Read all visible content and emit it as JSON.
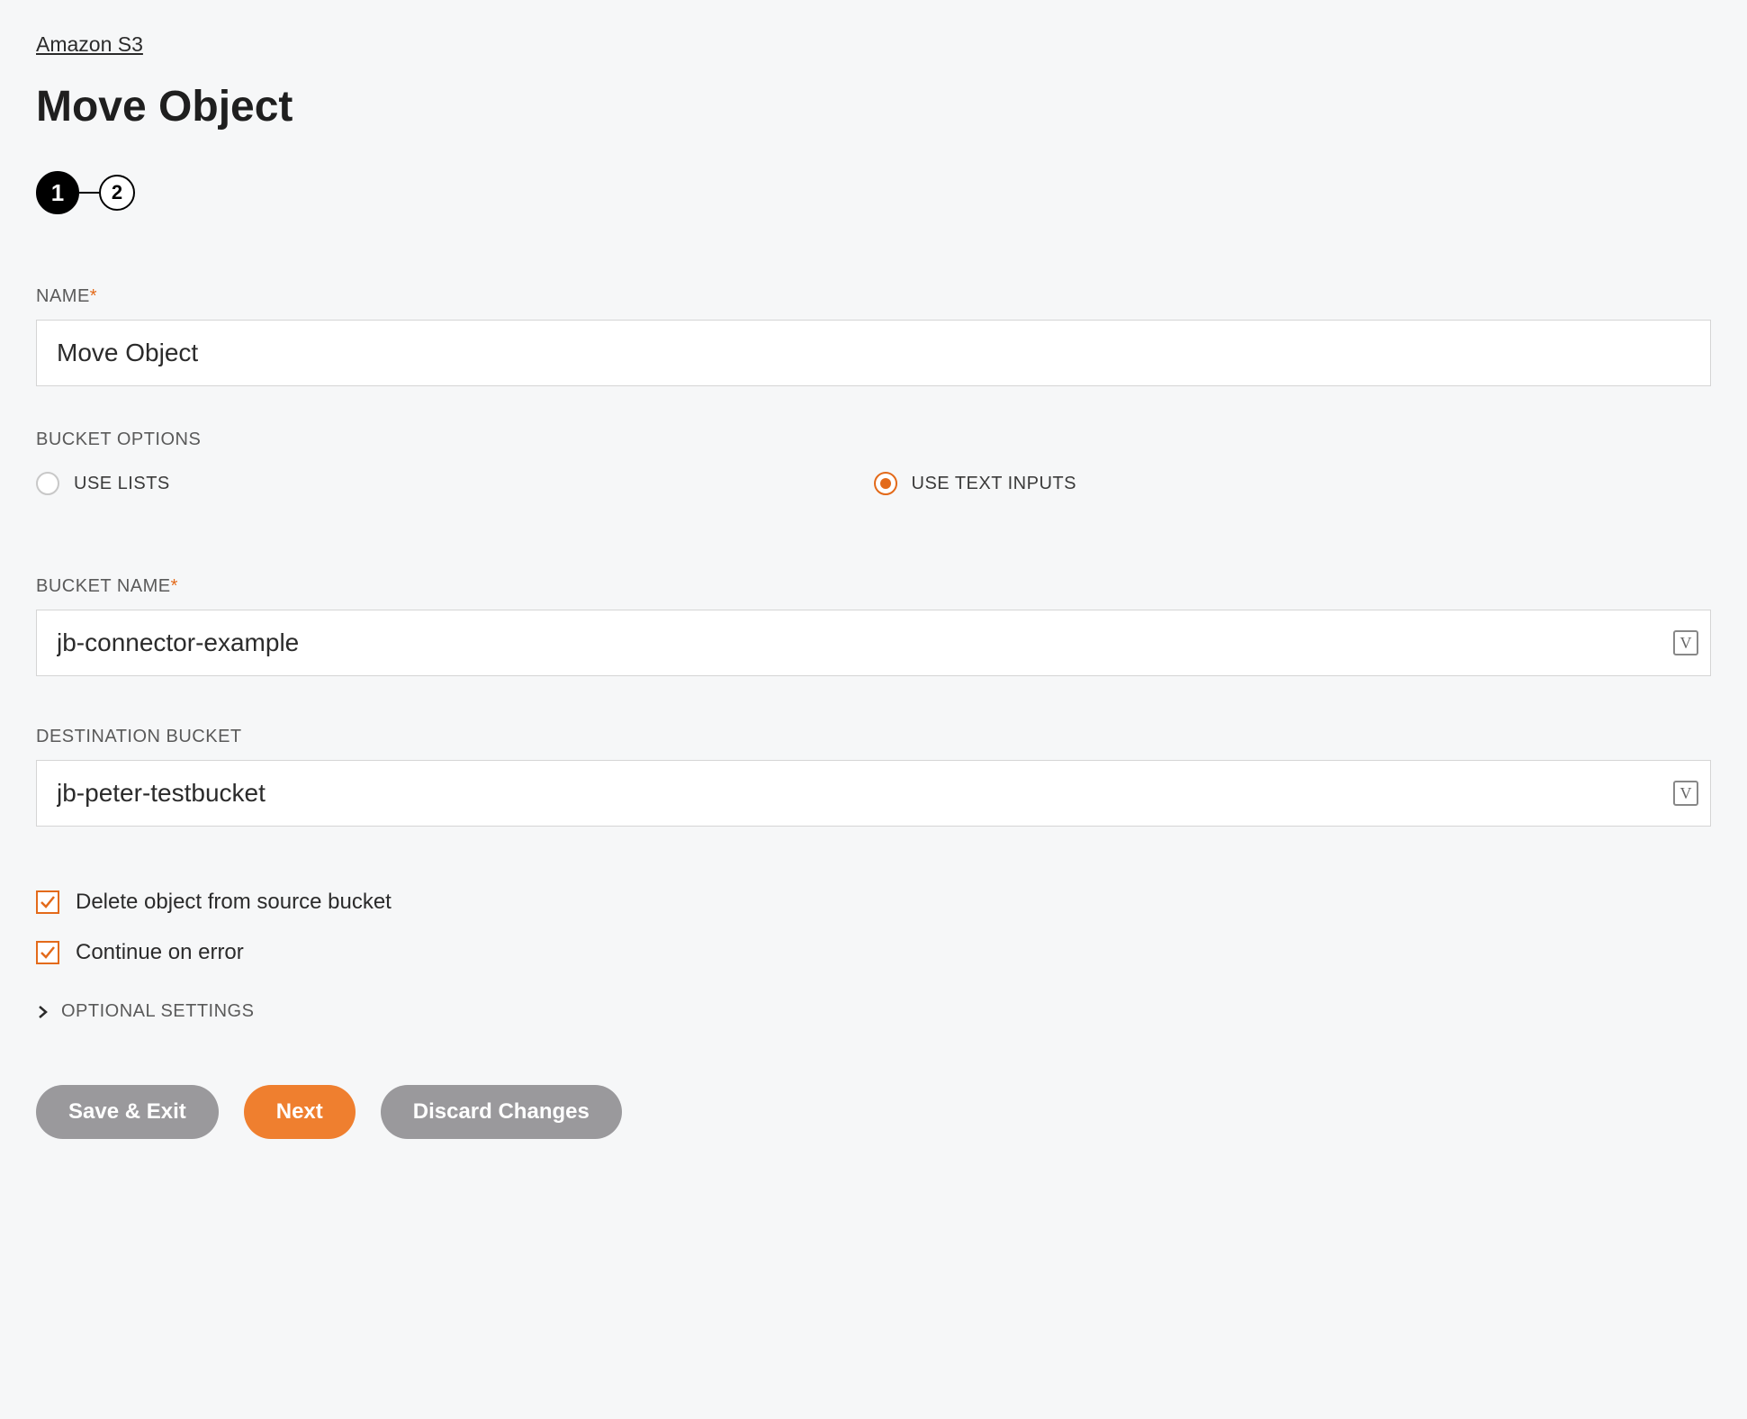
{
  "breadcrumb": {
    "label": "Amazon S3"
  },
  "page": {
    "title": "Move Object"
  },
  "stepper": {
    "step1": "1",
    "step2": "2"
  },
  "fields": {
    "name": {
      "label": "NAME",
      "value": "Move Object",
      "required": true
    },
    "bucket_options": {
      "label": "BUCKET OPTIONS",
      "opt_lists": "USE LISTS",
      "opt_text": "USE TEXT INPUTS",
      "selected": "text"
    },
    "bucket_name": {
      "label": "BUCKET NAME",
      "value": "jb-connector-example",
      "required": true
    },
    "dest_bucket": {
      "label": "DESTINATION BUCKET",
      "value": "jb-peter-testbucket"
    },
    "delete_source": {
      "label": "Delete object from source bucket",
      "checked": true
    },
    "continue_error": {
      "label": "Continue on error",
      "checked": true
    }
  },
  "expander": {
    "label": "OPTIONAL SETTINGS"
  },
  "buttons": {
    "save_exit": "Save & Exit",
    "next": "Next",
    "discard": "Discard Changes"
  },
  "icons": {
    "variable_badge": "V"
  }
}
